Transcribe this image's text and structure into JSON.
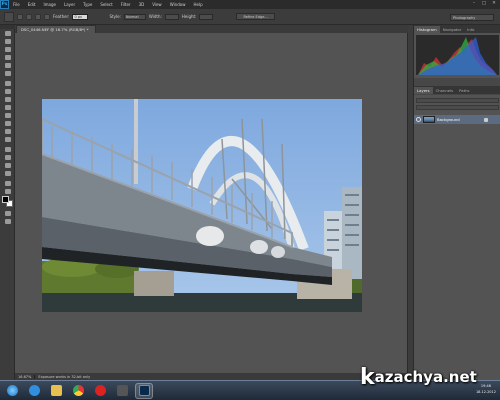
{
  "app": {
    "logo": "Ps"
  },
  "menu": [
    "File",
    "Edit",
    "Image",
    "Layer",
    "Type",
    "Select",
    "Filter",
    "3D",
    "View",
    "Window",
    "Help"
  ],
  "window_controls": [
    "–",
    "□",
    "✕"
  ],
  "options_bar": {
    "feather_label": "Feather:",
    "feather_value": "0 px",
    "style_label": "Style:",
    "style_value": "Normal",
    "width_label": "Width:",
    "height_label": "Height:",
    "refine_edge": "Refine Edge...",
    "workspace": "Photography"
  },
  "document": {
    "tab_title": "DSC_0446.NEF @ 16.7% (RGB/8*) *",
    "zoom": "16.67%",
    "info": "Exposure works in 32-bit only"
  },
  "panels": {
    "top_tabs": [
      "Histogram",
      "Navigator",
      "Info"
    ],
    "layer_tabs": [
      "Layers",
      "Channels",
      "Paths"
    ],
    "layer_name": "Background"
  },
  "taskbar": {
    "clock_time": "19:46",
    "clock_date": "18.12.2012"
  },
  "watermark": {
    "text": "azachya.net",
    "k": "k"
  },
  "colors": {
    "photoshop_accent": "#29a8e0",
    "workspace_bg": "#535353",
    "sky": "#8fb4e0",
    "water": "#2e3b3a",
    "layer_highlight": "#5d6b80"
  }
}
